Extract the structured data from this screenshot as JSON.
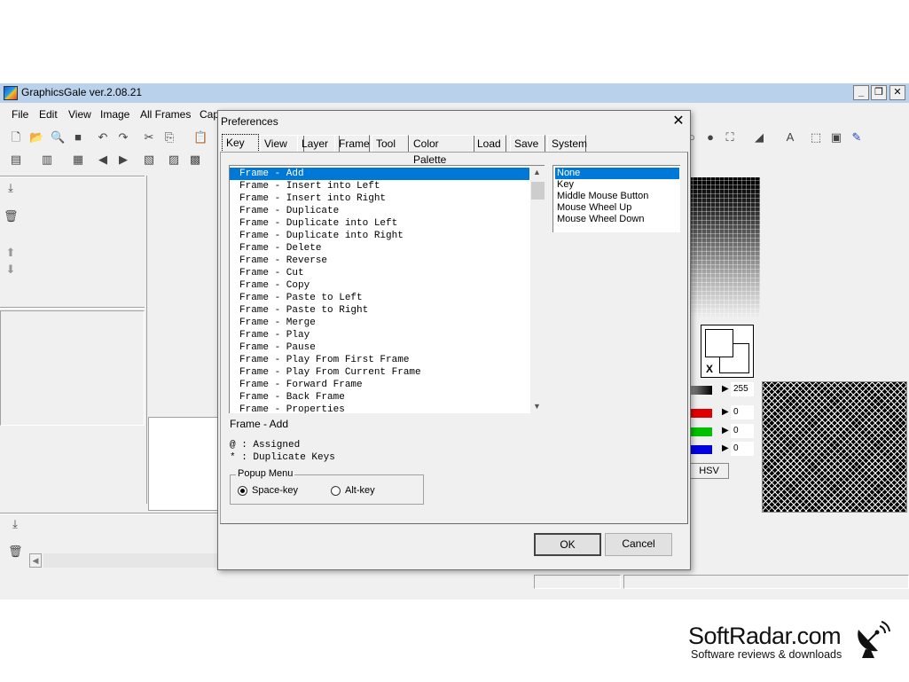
{
  "app": {
    "title": "GraphicsGale ver.2.08.21",
    "min_label": "_",
    "max_label": "❐",
    "close_label": "✕"
  },
  "menu": {
    "items": [
      "File",
      "Edit",
      "View",
      "Image",
      "All Frames",
      "Cap"
    ]
  },
  "side_panel": {
    "values": {
      "v1": "255",
      "v2": "0",
      "v3": "0",
      "v4": "0"
    },
    "hsv_label": "HSV",
    "x_label": "X"
  },
  "dialog": {
    "title": "Preferences",
    "close_label": "✕",
    "tabs": [
      "Key",
      "View",
      "Layer",
      "Frame",
      "Tool",
      "Color Palette",
      "Load",
      "Save",
      "System"
    ],
    "active_tab": "Key",
    "commands": [
      "Frame - Add",
      "Frame - Insert into Left",
      "Frame - Insert into Right",
      "Frame - Duplicate",
      "Frame - Duplicate into Left",
      "Frame - Duplicate into Right",
      "Frame - Delete",
      "Frame - Reverse",
      "Frame - Cut",
      "Frame - Copy",
      "Frame - Paste to Left",
      "Frame - Paste to Right",
      "Frame - Merge",
      "Frame - Play",
      "Frame - Pause",
      "Frame - Play From First Frame",
      "Frame - Play From Current Frame",
      "Frame - Forward Frame",
      "Frame - Back Frame",
      "Frame - Properties"
    ],
    "key_options": [
      "None",
      "Key",
      "Middle Mouse Button",
      "Mouse Wheel Up",
      "Mouse Wheel Down"
    ],
    "selected_command_label": "Frame - Add",
    "legend_assigned": "@ : Assigned",
    "legend_duplicate": "* : Duplicate Keys",
    "popup_menu": {
      "label": "Popup Menu",
      "options": [
        "Space-key",
        "Alt-key"
      ]
    },
    "ok_label": "OK",
    "cancel_label": "Cancel"
  },
  "watermark": {
    "brand": "SoftRadar.com",
    "tagline": "Software reviews & downloads"
  },
  "colors": {
    "selection": "#0078d7",
    "titlebar": "#b9d1ea",
    "red": "#e00000",
    "green": "#00c000",
    "blue": "#0000e0"
  }
}
